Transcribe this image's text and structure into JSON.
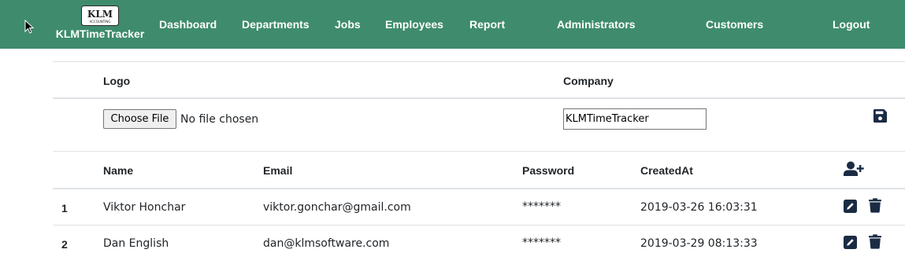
{
  "app": {
    "brand_name": "KLMTimeTracker",
    "brand_logo_text": "KLM",
    "brand_logo_subtext": "ACCOUNTING"
  },
  "nav": {
    "items": [
      {
        "label": "Dashboard"
      },
      {
        "label": "Departments"
      },
      {
        "label": "Jobs"
      },
      {
        "label": "Employees"
      },
      {
        "label": "Report"
      },
      {
        "label": "Administrators"
      },
      {
        "label": "Customers"
      },
      {
        "label": "Logout"
      }
    ]
  },
  "company_form": {
    "logo_header": "Logo",
    "company_header": "Company",
    "choose_file_label": "Choose File",
    "file_status": "No file chosen",
    "company_value": "KLMTimeTracker"
  },
  "admins": {
    "headers": {
      "name": "Name",
      "email": "Email",
      "password": "Password",
      "created_at": "CreatedAt"
    },
    "rows": [
      {
        "index": "1",
        "name": "Viktor Honchar",
        "email": "viktor.gonchar@gmail.com",
        "password": "*******",
        "created_at": "2019-03-26 16:03:31"
      },
      {
        "index": "2",
        "name": "Dan English",
        "email": "dan@klmsoftware.com",
        "password": "*******",
        "created_at": "2019-03-29 08:13:33"
      }
    ]
  },
  "icons": {
    "save": "save-icon",
    "add_user": "user-plus-icon",
    "edit": "edit-icon",
    "delete": "trash-icon",
    "cursor": "mouse-cursor-icon"
  },
  "colors": {
    "navbar": "#3e8c6d",
    "nav_text": "#ffffff",
    "icon": "#1a2b44",
    "border": "#dee2e6"
  }
}
